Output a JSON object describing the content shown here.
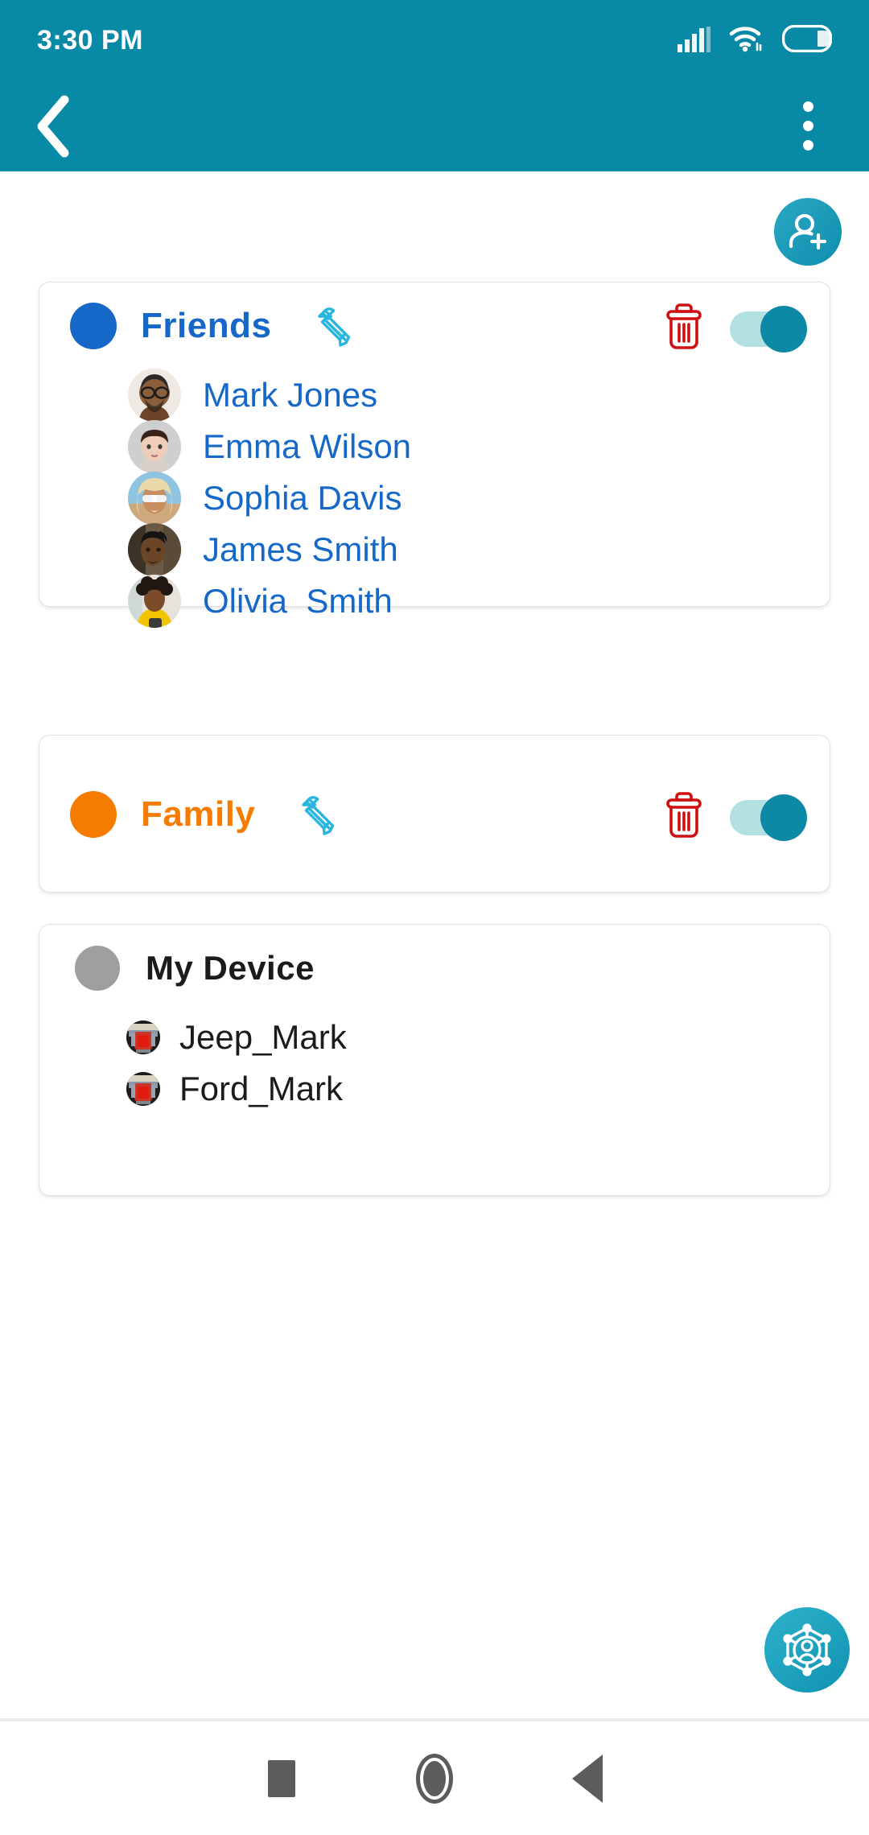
{
  "status_bar": {
    "time": "3:30 PM",
    "icons": [
      "cellular-signal-icon",
      "wifi-icon",
      "battery-icon"
    ]
  },
  "app_bar": {
    "back_icon": "chevron-left-icon",
    "overflow_icon": "more-vertical-icon",
    "background_color": "#0889a6"
  },
  "toolbar": {
    "add_user_icon": "add-user-icon"
  },
  "groups": [
    {
      "name": "Friends",
      "dot_color": "#1668c8",
      "title_color": "#1668c8",
      "edit_icon": "pencil-icon",
      "delete_icon": "trash-icon",
      "toggle_state": "on",
      "members": [
        {
          "name": "Mark Jones",
          "avatar": "avatar-mark-jones"
        },
        {
          "name": "Emma Wilson",
          "avatar": "avatar-emma-wilson"
        },
        {
          "name": "Sophia Davis",
          "avatar": "avatar-sophia-davis"
        },
        {
          "name": "James Smith",
          "avatar": "avatar-james-smith"
        },
        {
          "name": "Olivia  Smith",
          "avatar": "avatar-olivia-smith"
        }
      ]
    },
    {
      "name": "Family",
      "dot_color": "#f57c00",
      "title_color": "#f57c00",
      "edit_icon": "pencil-icon",
      "delete_icon": "trash-icon",
      "toggle_state": "on",
      "members": []
    },
    {
      "name": "My Device",
      "dot_color": "#9e9e9e",
      "title_color": "#1b1b1b",
      "members": [
        {
          "name": "Jeep_Mark",
          "avatar": "avatar-vehicle-jeep"
        },
        {
          "name": "Ford_Mark",
          "avatar": "avatar-vehicle-ford"
        }
      ]
    }
  ],
  "fab": {
    "icon": "network-people-icon",
    "color": "#1a9bb8"
  },
  "nav_bar": {
    "recents_icon": "square-icon",
    "home_icon": "circle-icon",
    "back_icon": "triangle-left-icon"
  },
  "colors": {
    "header_teal": "#0889a6",
    "accent_blue": "#1668c8",
    "accent_orange": "#f57c00",
    "delete_red": "#cf1010",
    "edit_cyan": "#29b6dd",
    "toggle_track": "#b3e0e0",
    "toggle_thumb": "#0d89a6",
    "device_gray": "#9e9e9e"
  }
}
